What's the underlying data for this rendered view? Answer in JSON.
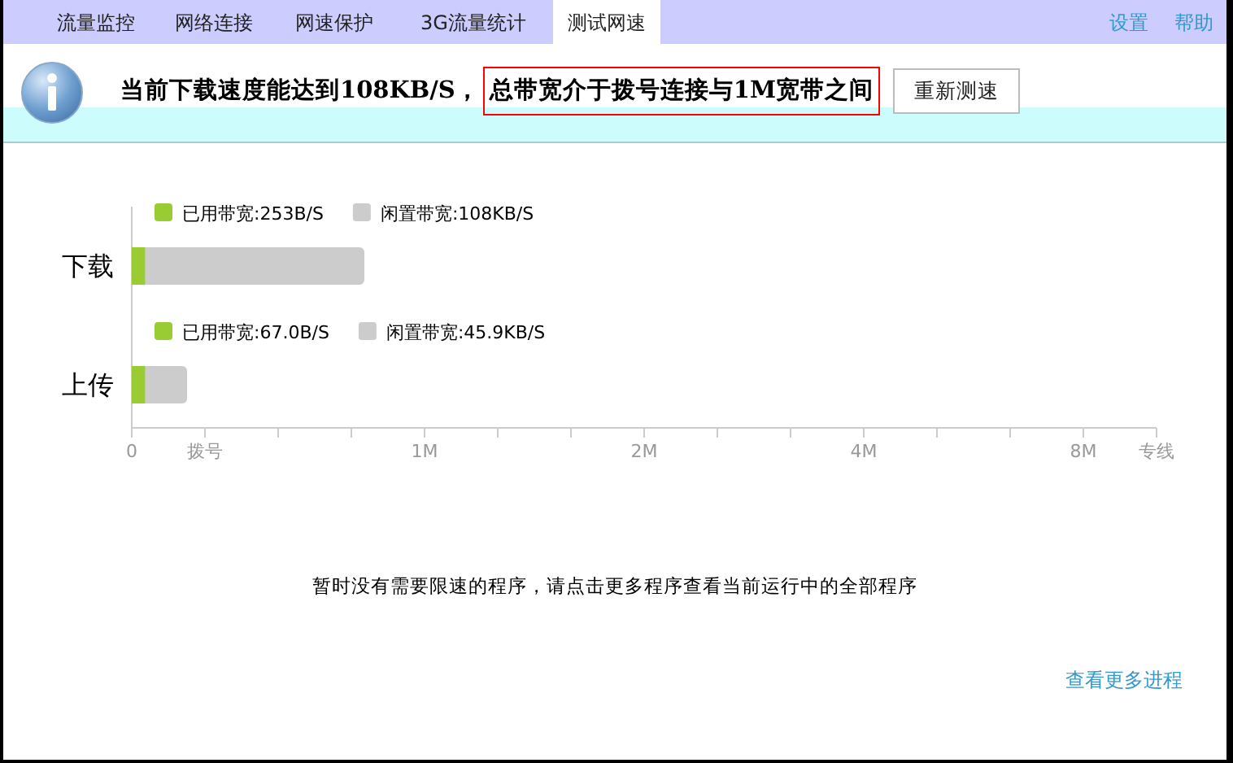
{
  "tabs": [
    {
      "label": "流量监控",
      "selected": false
    },
    {
      "label": "网络连接",
      "selected": false
    },
    {
      "label": "网速保护",
      "selected": false
    },
    {
      "label": "3G流量统计",
      "selected": false
    },
    {
      "label": "测试网速",
      "selected": true
    }
  ],
  "top_links": [
    {
      "label": "设置"
    },
    {
      "label": "帮助"
    }
  ],
  "result": {
    "text": "当前下载速度能达到108KB/S，",
    "highlight": "总带宽介于拨号连接与1M宽带之间",
    "button": "重新测速"
  },
  "speed_chart": {
    "rows": [
      {
        "label": "下载",
        "legend": [
          {
            "kind": "used",
            "text": "已用带宽:253B/S"
          },
          {
            "kind": "idle",
            "text": "闲置带宽:108KB/S"
          }
        ],
        "bar": [
          {
            "kind": "total",
            "level": 0.227
          },
          {
            "kind": "used",
            "level": 0.013
          }
        ]
      },
      {
        "label": "上传",
        "legend": [
          {
            "kind": "used",
            "text": "已用带宽:67.0B/S"
          },
          {
            "kind": "idle",
            "text": "闲置带宽:45.9KB/S"
          }
        ],
        "bar": [
          {
            "kind": "total",
            "level": 0.054
          },
          {
            "kind": "used",
            "level": 0.013
          }
        ]
      }
    ],
    "ticks": [
      {
        "kind": "labeled",
        "label": "0"
      },
      {
        "kind": "labeled",
        "label": "拨号"
      },
      {
        "kind": "minor"
      },
      {
        "kind": "minor"
      },
      {
        "kind": "labeled",
        "label": "1M"
      },
      {
        "kind": "minor"
      },
      {
        "kind": "minor"
      },
      {
        "kind": "labeled",
        "label": "2M"
      },
      {
        "kind": "minor"
      },
      {
        "kind": "minor"
      },
      {
        "kind": "labeled",
        "label": "4M"
      },
      {
        "kind": "minor"
      },
      {
        "kind": "minor"
      },
      {
        "kind": "labeled",
        "label": "8M"
      },
      {
        "kind": "labeled",
        "label": "专线"
      }
    ]
  },
  "message": "暂时没有需要限速的程序，请点击更多程序查看当前运行中的全部程序",
  "more_link": "查看更多进程"
}
